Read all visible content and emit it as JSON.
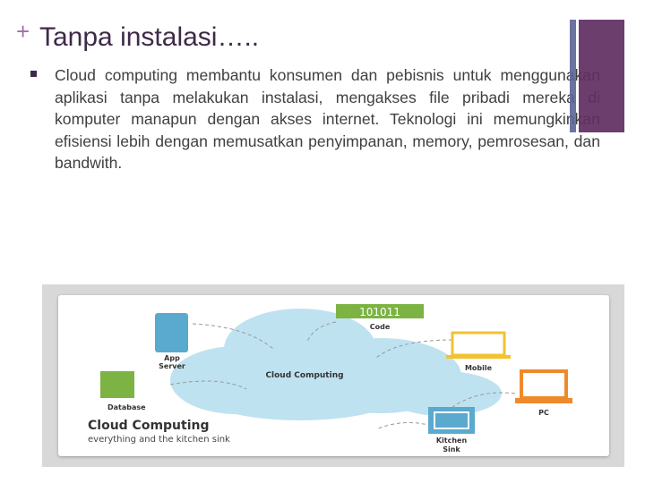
{
  "slide": {
    "title_marker": "+",
    "title": "Tanpa instalasi…..",
    "bullet": "Cloud computing membantu konsumen dan pebisnis untuk menggunakan aplikasi tanpa melakukan instalasi, mengakses file pribadi mereka di komputer manapun dengan akses internet. Teknologi ini memungkinkan efisiensi lebih dengan memusatkan penyimpanan, memory, pemrosesan, dan bandwith."
  },
  "figure": {
    "center_label": "Cloud Computing",
    "code_badge": "101011",
    "labels": {
      "code": "Code",
      "app_server_1": "App",
      "app_server_2": "Server",
      "mobile": "Mobile",
      "database": "Database",
      "pc": "PC",
      "kitchen_1": "Kitchen",
      "kitchen_2": "Sink"
    },
    "heading": "Cloud Computing",
    "subheading": "everything and the kitchen sink",
    "colors": {
      "cloud": "#bfe2f0",
      "code": "#7cb342",
      "app_server": "#5aa9cf",
      "mobile": "#f2c230",
      "database": "#7cb342",
      "pc": "#ef8a2c",
      "kitchen": "#5aa9cf"
    }
  }
}
